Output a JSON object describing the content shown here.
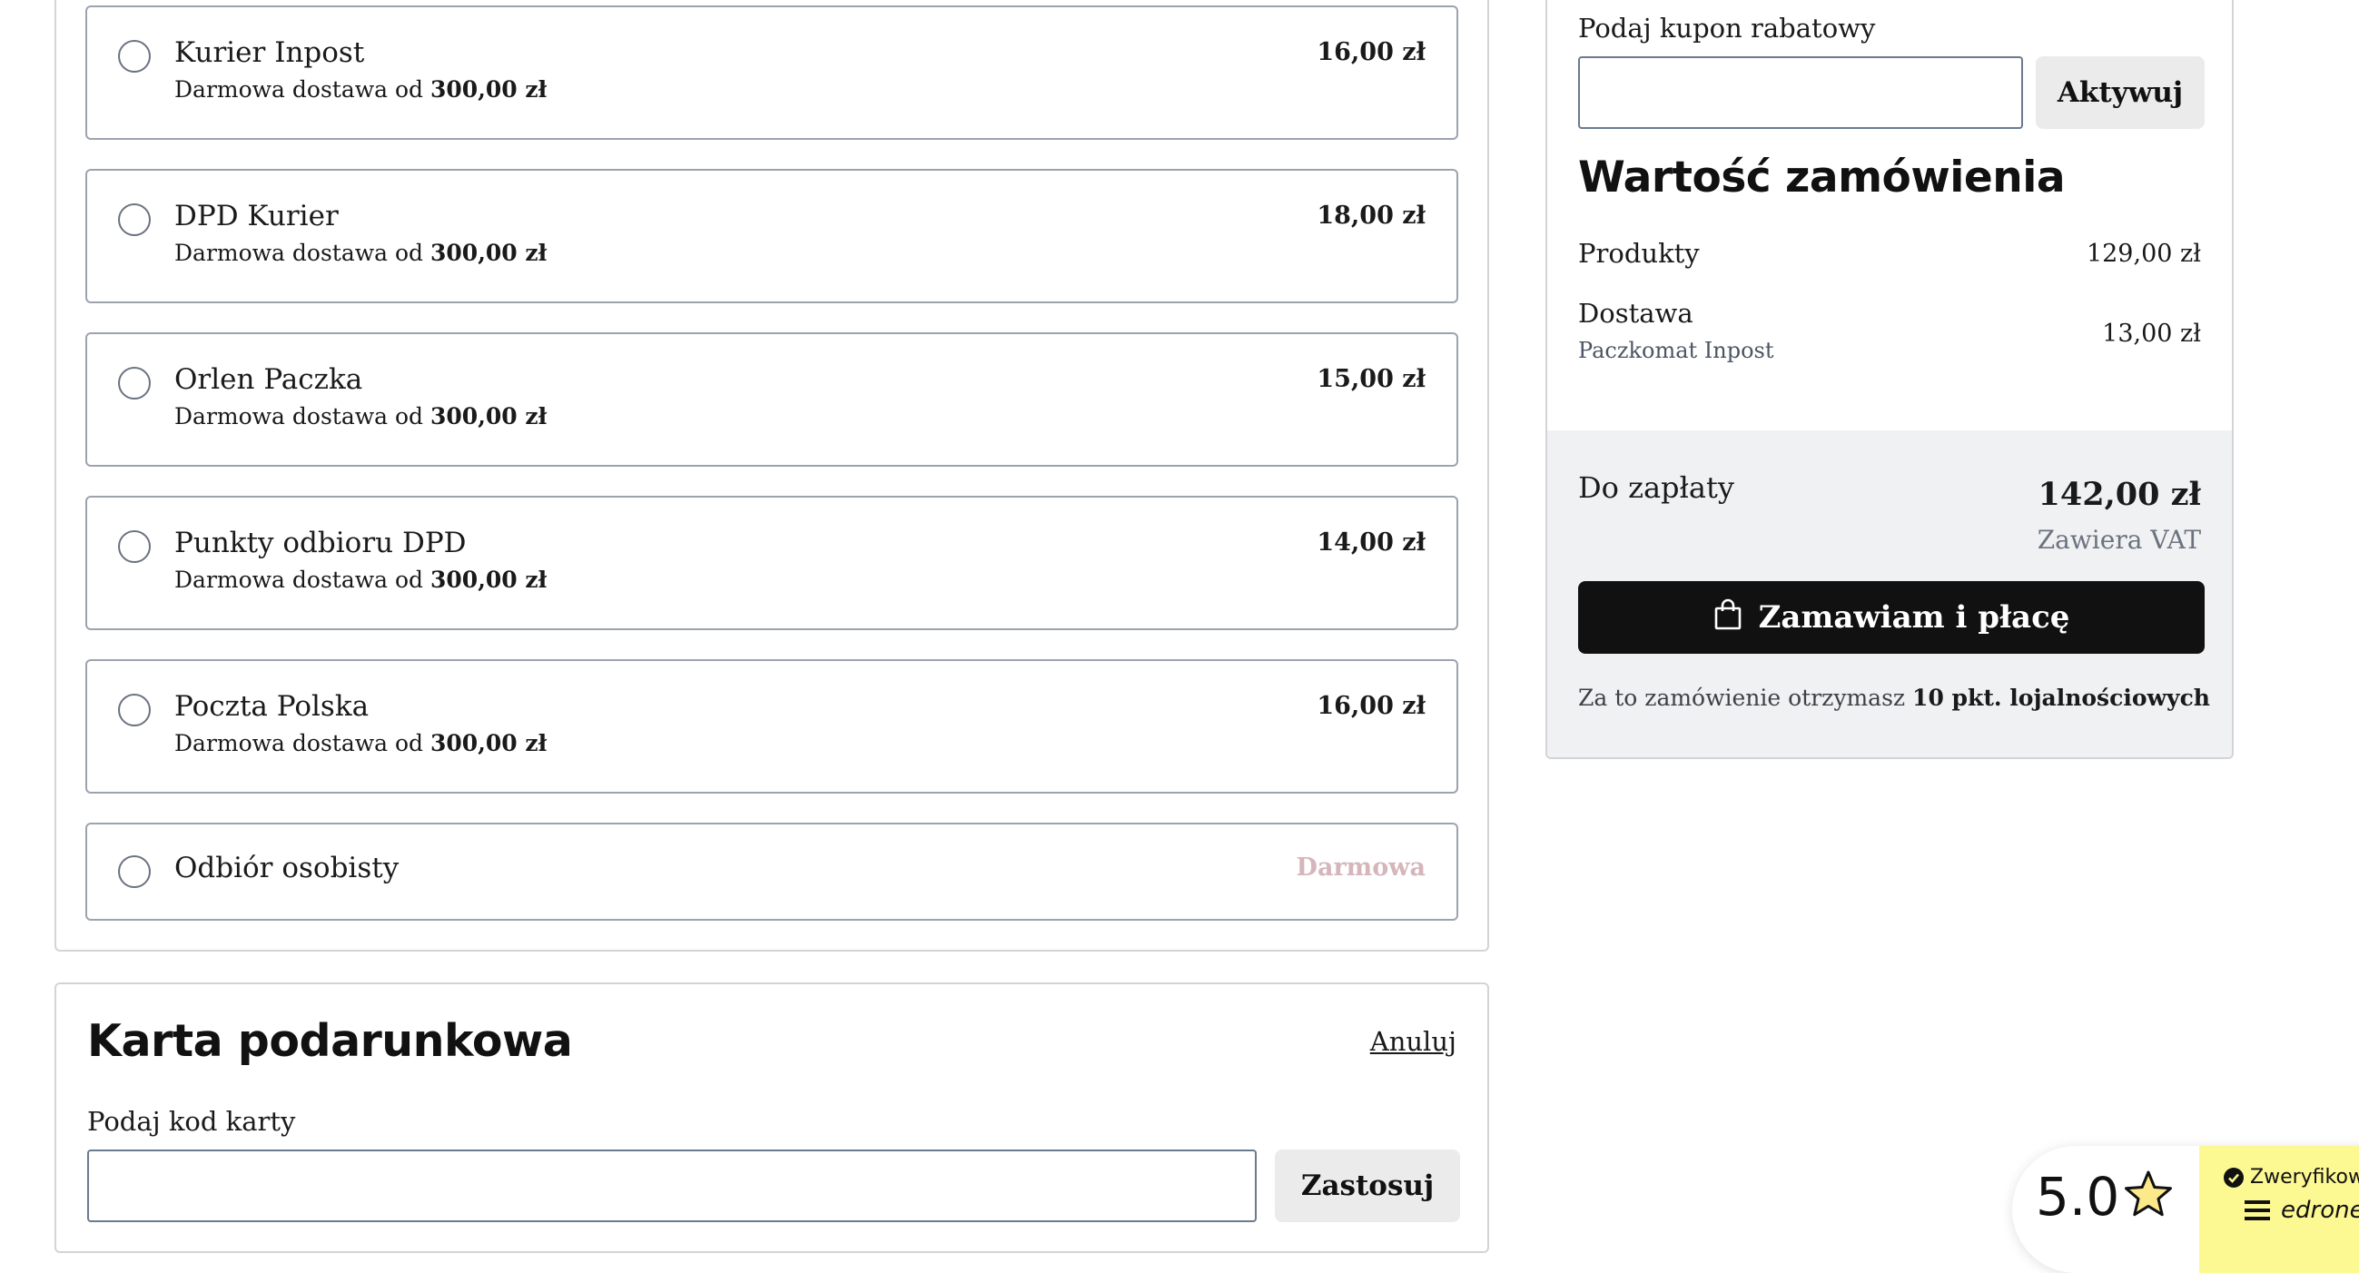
{
  "shipping": {
    "options": [
      {
        "name": "Kurier Inpost",
        "sub_prefix": "Darmowa dostawa od",
        "threshold": "300,00 zł",
        "price": "16,00 zł"
      },
      {
        "name": "DPD Kurier",
        "sub_prefix": "Darmowa dostawa od",
        "threshold": "300,00 zł",
        "price": "18,00 zł"
      },
      {
        "name": "Orlen Paczka",
        "sub_prefix": "Darmowa dostawa od",
        "threshold": "300,00 zł",
        "price": "15,00 zł"
      },
      {
        "name": "Punkty odbioru DPD",
        "sub_prefix": "Darmowa dostawa od",
        "threshold": "300,00 zł",
        "price": "14,00 zł"
      },
      {
        "name": "Poczta Polska",
        "sub_prefix": "Darmowa dostawa od",
        "threshold": "300,00 zł",
        "price": "16,00 zł"
      },
      {
        "name": "Odbiór osobisty",
        "price": "Darmowa"
      }
    ]
  },
  "gift_card": {
    "title": "Karta podarunkowa",
    "cancel_label": "Anuluj",
    "input_label": "Podaj kod karty",
    "input_value": "",
    "apply_label": "Zastosuj"
  },
  "summary": {
    "coupon_label": "Podaj kupon rabatowy",
    "coupon_value": "",
    "coupon_button": "Aktywuj",
    "title": "Wartość zamówienia",
    "products_label": "Produkty",
    "products_value": "129,00 zł",
    "delivery_label": "Dostawa",
    "delivery_method": "Paczkomat Inpost",
    "delivery_value": "13,00 zł",
    "total_label": "Do zapłaty",
    "total_value": "142,00 zł",
    "vat_note": "Zawiera VAT",
    "order_button": "Zamawiam i płacę",
    "loyalty_prefix": "Za to zamówienie otrzymasz",
    "loyalty_points": "10 pkt. lojalnościowych"
  },
  "rating_widget": {
    "score": "5.0",
    "verified_label": "Zweryfikowa",
    "brand": "edrone",
    "accent_color": "#fcf892"
  },
  "colors": {
    "border": "#9ca3af",
    "button_dark": "#111111",
    "summary_bg": "#f0f1f2",
    "free_price": "#d4b6bb"
  }
}
